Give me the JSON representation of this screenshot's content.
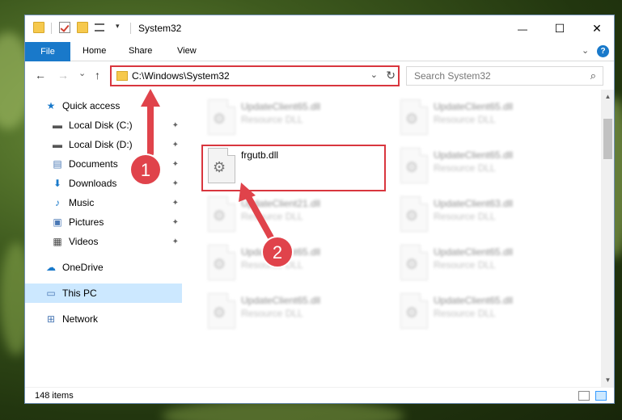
{
  "window": {
    "title": "System32",
    "minimize": "—",
    "maximize": "☐",
    "close": "✕"
  },
  "ribbon": {
    "tabs": [
      "File",
      "Home",
      "Share",
      "View"
    ],
    "expand": "⌄",
    "help": "?"
  },
  "nav": {
    "back": "←",
    "forward": "→",
    "recent": "⌄",
    "up": "↑"
  },
  "address": {
    "path": "C:\\Windows\\System32",
    "dropdown": "⌄",
    "refresh": "↻"
  },
  "search": {
    "placeholder": "Search System32",
    "icon": "⌕"
  },
  "sidebar": {
    "items": [
      {
        "label": "Quick access",
        "icon": "star-icon",
        "glyph": "★",
        "pinned": false
      },
      {
        "label": "Local Disk (C:)",
        "icon": "drive-icon",
        "glyph": "▬",
        "pinned": true
      },
      {
        "label": "Local Disk (D:)",
        "icon": "drive-icon",
        "glyph": "▬",
        "pinned": true
      },
      {
        "label": "Documents",
        "icon": "documents-icon",
        "glyph": "▤",
        "pinned": true
      },
      {
        "label": "Downloads",
        "icon": "downloads-icon",
        "glyph": "⬇",
        "pinned": true
      },
      {
        "label": "Music",
        "icon": "music-icon",
        "glyph": "♪",
        "pinned": true
      },
      {
        "label": "Pictures",
        "icon": "pictures-icon",
        "glyph": "▣",
        "pinned": true
      },
      {
        "label": "Videos",
        "icon": "videos-icon",
        "glyph": "▦",
        "pinned": true
      },
      {
        "label": "OneDrive",
        "icon": "cloud-icon",
        "glyph": "☁",
        "pinned": false
      },
      {
        "label": "This PC",
        "icon": "computer-icon",
        "glyph": "▭",
        "pinned": false
      },
      {
        "label": "Network",
        "icon": "network-icon",
        "glyph": "⊞",
        "pinned": false
      }
    ],
    "pin_glyph": "📌"
  },
  "files": {
    "left": [
      {
        "name": "UpdateClient65.dll",
        "type": "Resource DLL",
        "blurred": true
      },
      {
        "name": "frgutb.dll",
        "type": "",
        "blurred": false
      },
      {
        "name": "UpdateClient21.dll",
        "type": "Resource DLL",
        "blurred": true
      },
      {
        "name": "UpdateClient65.dll",
        "type": "Resource DLL",
        "blurred": true
      },
      {
        "name": "UpdateClient65.dll",
        "type": "Resource DLL",
        "blurred": true
      }
    ],
    "right": [
      {
        "name": "UpdateClient65.dll",
        "type": "Resource DLL",
        "blurred": true
      },
      {
        "name": "UpdateClient65.dll",
        "type": "Resource DLL",
        "blurred": true
      },
      {
        "name": "UpdateClient63.dll",
        "type": "Resource DLL",
        "blurred": true
      },
      {
        "name": "UpdateClient65.dll",
        "type": "Resource DLL",
        "blurred": true
      },
      {
        "name": "UpdateClient65.dll",
        "type": "Resource DLL",
        "blurred": true
      }
    ]
  },
  "status": {
    "count": "148 items"
  },
  "annotations": {
    "step1": "1",
    "step2": "2",
    "color": "#e0434b"
  },
  "colors": {
    "accent": "#1979ca",
    "highlight": "#d9363e",
    "selected": "#cce8ff"
  }
}
